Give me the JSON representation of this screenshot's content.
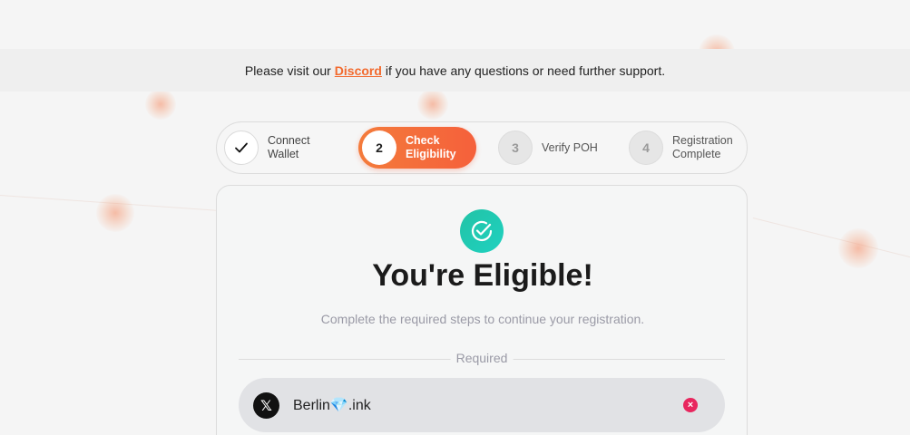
{
  "banner": {
    "prefix": "Please visit our",
    "link_label": "Discord",
    "suffix": "if you have any questions or need further support."
  },
  "stepper": {
    "steps": [
      {
        "number": "",
        "line1": "Connect",
        "line2": "Wallet",
        "state": "done",
        "icon": "check-icon"
      },
      {
        "number": "2",
        "line1": "Check",
        "line2": "Eligibility",
        "state": "active"
      },
      {
        "number": "3",
        "line1": "Verify POH",
        "line2": "",
        "state": "todo"
      },
      {
        "number": "4",
        "line1": "Registration",
        "line2": "Complete",
        "state": "todo"
      }
    ]
  },
  "card": {
    "icon": "check-circle-icon",
    "title": "You're Eligible!",
    "subtitle": "Complete the required steps to continue your registration.",
    "section_label": "Required",
    "tasks": [
      {
        "platform_icon": "x-logo-icon",
        "handle": "Berlin💎.ink",
        "status_icon": "error-icon"
      }
    ]
  },
  "colors": {
    "accent": "#f5603b",
    "link": "#f26a2e",
    "success": "#22c3a6",
    "error": "#e8265e"
  }
}
